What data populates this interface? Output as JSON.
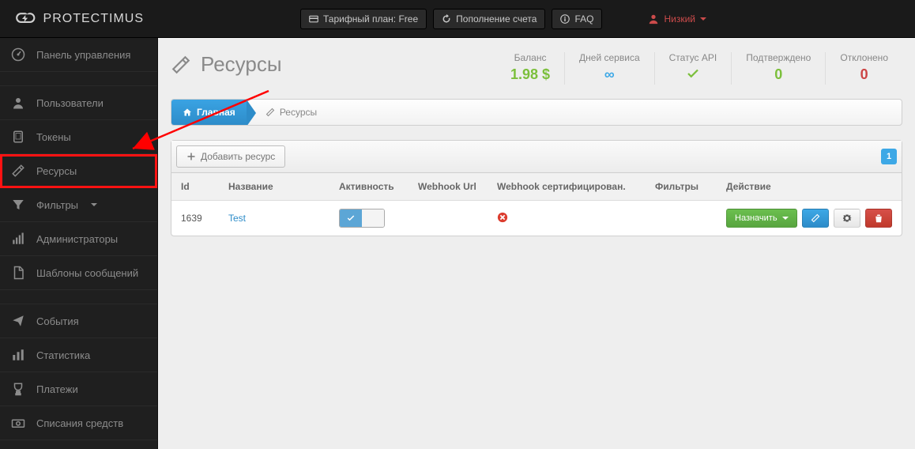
{
  "brand": "PROTECTIMUS",
  "topbar": {
    "tariff": "Тарифный план: Free",
    "topup": "Пополнение счета",
    "faq": "FAQ",
    "user": "Низкий"
  },
  "sidebar": {
    "items": [
      {
        "label": "Панель управления"
      },
      {
        "label": "Пользователи"
      },
      {
        "label": "Токены"
      },
      {
        "label": "Ресурсы"
      },
      {
        "label": "Фильтры"
      },
      {
        "label": "Администраторы"
      },
      {
        "label": "Шаблоны сообщений"
      },
      {
        "label": "События"
      },
      {
        "label": "Статистика"
      },
      {
        "label": "Платежи"
      },
      {
        "label": "Списания средств"
      }
    ]
  },
  "page": {
    "title": "Ресурсы",
    "stats": {
      "balance_label": "Баланс",
      "balance_value": "1.98 $",
      "days_label": "Дней сервиса",
      "days_value": "∞",
      "api_label": "Статус API",
      "confirmed_label": "Подтверждено",
      "confirmed_value": "0",
      "rejected_label": "Отклонено",
      "rejected_value": "0"
    }
  },
  "breadcrumb": {
    "home": "Главная",
    "current": "Ресурсы"
  },
  "table": {
    "add_label": "Добавить ресурс",
    "page_num": "1",
    "headers": {
      "id": "Id",
      "name": "Название",
      "active": "Активность",
      "webhook": "Webhook Url",
      "cert": "Webhook сертифицирован.",
      "filters": "Фильтры",
      "action": "Действие"
    },
    "rows": [
      {
        "id": "1639",
        "name": "Test"
      }
    ],
    "assign_label": "Назначить"
  }
}
